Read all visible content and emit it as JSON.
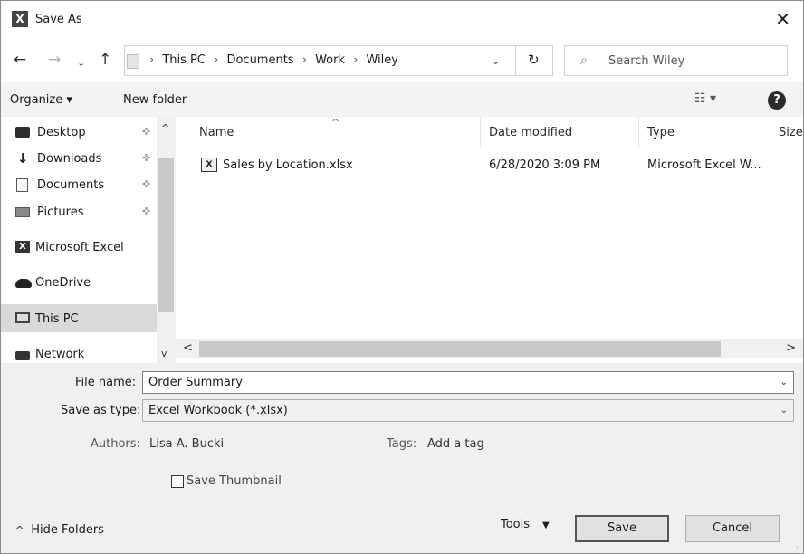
{
  "window": {
    "title": "Save As",
    "app_icon_letter": "X",
    "close_glyph": "✕"
  },
  "navigation": {
    "back_glyph": "←",
    "forward_glyph": "→",
    "recent_glyph": "⌄",
    "up_glyph": "↑",
    "breadcrumb": [
      "This PC",
      "Documents",
      "Work",
      "Wiley"
    ],
    "breadcrumb_separator": "›",
    "dropdown_glyph": "⌄",
    "refresh_glyph": "↻",
    "search_placeholder": "Search Wiley"
  },
  "toolbar": {
    "organize_label": "Organize ▾",
    "new_folder_label": "New folder",
    "view_glyph": "☷ ▾",
    "help_glyph": "?"
  },
  "sidebar": {
    "items": [
      {
        "label": "Desktop",
        "icon": "desktop-icon",
        "pinned": true
      },
      {
        "label": "Downloads",
        "icon": "download-icon",
        "pinned": true
      },
      {
        "label": "Documents",
        "icon": "documents-icon",
        "pinned": true
      },
      {
        "label": "Pictures",
        "icon": "pictures-icon",
        "pinned": true
      },
      {
        "label": "Microsoft Excel",
        "icon": "excel-icon",
        "pinned": false
      },
      {
        "label": "OneDrive",
        "icon": "cloud-icon",
        "pinned": false
      },
      {
        "label": "This PC",
        "icon": "computer-icon",
        "pinned": false,
        "selected": true
      },
      {
        "label": "Network",
        "icon": "network-icon",
        "pinned": false
      }
    ],
    "pin_glyph": "✜",
    "scroll_up_glyph": "^",
    "scroll_down_glyph": "v"
  },
  "file_list": {
    "columns": [
      "Name",
      "Date modified",
      "Type",
      "Size"
    ],
    "sort_glyph": "^",
    "rows": [
      {
        "name": "Sales by Location.xlsx",
        "date_modified": "6/28/2020 3:09 PM",
        "type": "Microsoft Excel W..."
      }
    ],
    "scroll_left_glyph": "<",
    "scroll_right_glyph": ">"
  },
  "form": {
    "file_name_label": "File name:",
    "file_name_value": "Order Summary",
    "save_as_type_label": "Save as type:",
    "save_as_type_value": "Excel Workbook (*.xlsx)",
    "authors_label": "Authors:",
    "authors_value": "Lisa A. Bucki",
    "tags_label": "Tags:",
    "tags_value": "Add a tag",
    "save_thumbnail_label": "Save Thumbnail",
    "save_thumbnail_checked": false,
    "dropdown_glyph": "⌄"
  },
  "footer": {
    "hide_folders_label": "Hide Folders",
    "hide_folders_glyph": "^",
    "tools_label": "Tools",
    "tools_glyph": "▼",
    "save_label": "Save",
    "cancel_label": "Cancel",
    "grip_glyph": ".:"
  }
}
